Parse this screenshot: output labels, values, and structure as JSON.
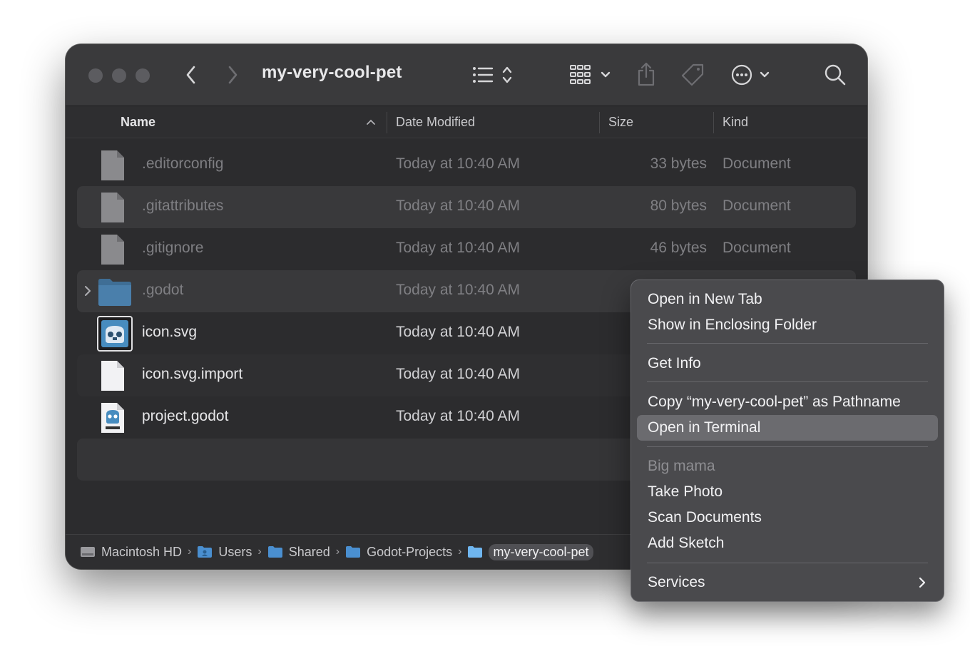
{
  "window": {
    "title": "my-very-cool-pet"
  },
  "columns": {
    "name": "Name",
    "date_modified": "Date Modified",
    "size": "Size",
    "kind": "Kind"
  },
  "files": [
    {
      "name": ".editorconfig",
      "date": "Today at 10:40 AM",
      "size": "33 bytes",
      "kind": "Document",
      "icon": "generic-document-icon"
    },
    {
      "name": ".gitattributes",
      "date": "Today at 10:40 AM",
      "size": "80 bytes",
      "kind": "Document",
      "icon": "generic-document-icon"
    },
    {
      "name": ".gitignore",
      "date": "Today at 10:40 AM",
      "size": "46 bytes",
      "kind": "Document",
      "icon": "generic-document-icon"
    },
    {
      "name": ".godot",
      "date": "Today at 10:40 AM",
      "size": "",
      "kind": "",
      "icon": "folder-icon"
    },
    {
      "name": "icon.svg",
      "date": "Today at 10:40 AM",
      "size": "",
      "kind": "",
      "icon": "godot-svg-icon"
    },
    {
      "name": "icon.svg.import",
      "date": "Today at 10:40 AM",
      "size": "",
      "kind": "",
      "icon": "blank-document-icon"
    },
    {
      "name": "project.godot",
      "date": "Today at 10:40 AM",
      "size": "",
      "kind": "",
      "icon": "godot-project-icon"
    }
  ],
  "path_bar": [
    {
      "label": "Macintosh HD",
      "icon": "hard-drive-icon"
    },
    {
      "label": "Users",
      "icon": "users-folder-icon"
    },
    {
      "label": "Shared",
      "icon": "folder-icon"
    },
    {
      "label": "Godot-Projects",
      "icon": "folder-icon"
    },
    {
      "label": "my-very-cool-pet",
      "icon": "folder-icon"
    }
  ],
  "context_menu": {
    "items": [
      {
        "label": "Open in New Tab"
      },
      {
        "label": "Show in Enclosing Folder"
      },
      {
        "label": "Get Info"
      },
      {
        "label": "Copy “my-very-cool-pet” as Pathname"
      },
      {
        "label": "Open in Terminal",
        "highlighted": true
      },
      {
        "label": "Big mama",
        "disabled": true
      },
      {
        "label": "Take Photo"
      },
      {
        "label": "Scan Documents"
      },
      {
        "label": "Add Sketch"
      },
      {
        "label": "Services",
        "submenu": true
      }
    ]
  },
  "colors": {
    "window_bg": "#2c2c2e",
    "toolbar_bg": "#3a3a3c",
    "menu_bg": "#4a4a4d",
    "highlight": "#6b6b6f",
    "folder_blue": "#4a8fd0"
  }
}
